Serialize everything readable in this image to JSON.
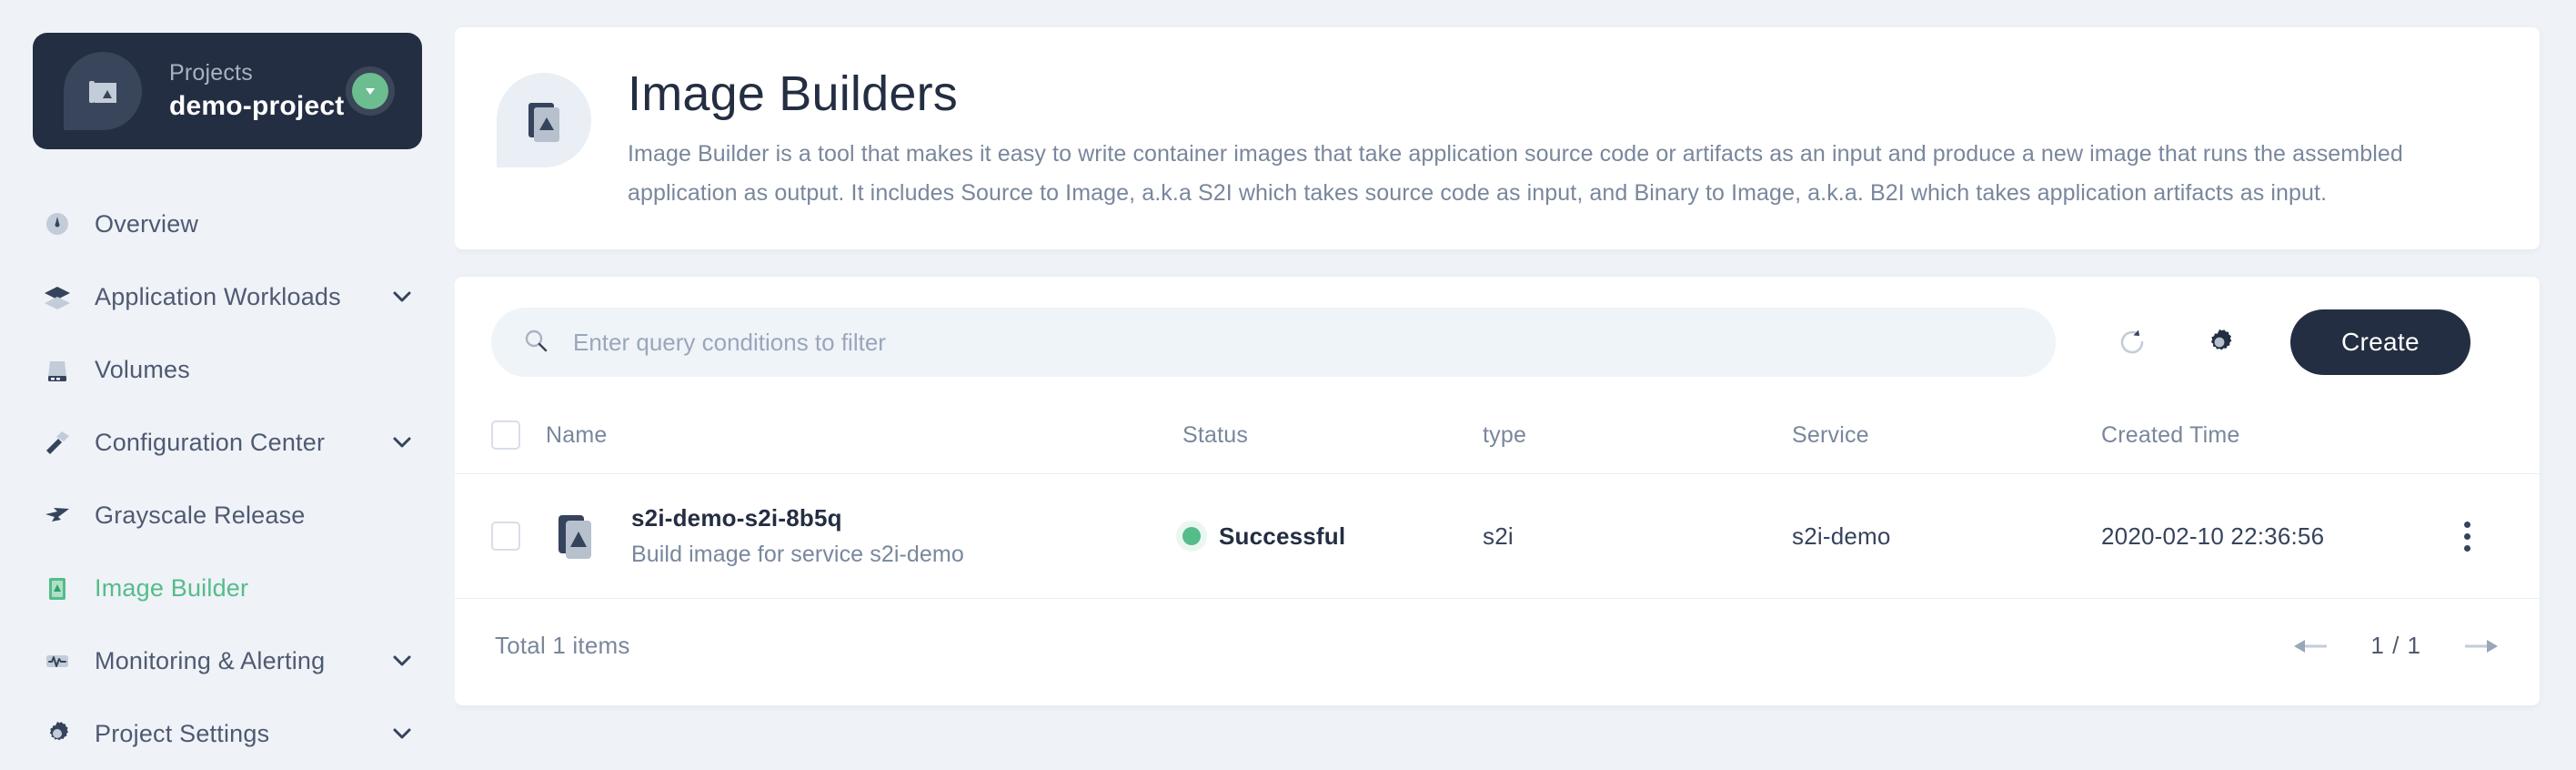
{
  "sidebar": {
    "project_card": {
      "label": "Projects",
      "name": "demo-project",
      "icon": "blueprint-icon",
      "badge_icon": "chevron-down-circle-icon"
    },
    "items": [
      {
        "label": "Overview",
        "icon": "dashboard-icon",
        "expandable": false,
        "active": false
      },
      {
        "label": "Application Workloads",
        "icon": "layers-icon",
        "expandable": true,
        "active": false
      },
      {
        "label": "Volumes",
        "icon": "storage-icon",
        "expandable": false,
        "active": false
      },
      {
        "label": "Configuration Center",
        "icon": "hammer-icon",
        "expandable": true,
        "active": false
      },
      {
        "label": "Grayscale Release",
        "icon": "bird-icon",
        "expandable": false,
        "active": false
      },
      {
        "label": "Image Builder",
        "icon": "image-build-icon",
        "expandable": false,
        "active": true
      },
      {
        "label": "Monitoring & Alerting",
        "icon": "pulse-icon",
        "expandable": true,
        "active": false
      },
      {
        "label": "Project Settings",
        "icon": "gear-icon",
        "expandable": true,
        "active": false
      }
    ]
  },
  "banner": {
    "icon": "image-build-icon",
    "title": "Image Builders",
    "description": "Image Builder is a tool that makes it easy to write container images that take application source code or artifacts as an input and produce a new image that runs the assembled application as output. It includes Source to Image, a.k.a S2I which takes source code as input, and Binary to Image, a.k.a. B2I which takes application artifacts as input."
  },
  "toolbar": {
    "search_placeholder": "Enter query conditions to filter",
    "search_value": "",
    "search_icon": "search-icon",
    "refresh_icon": "refresh-icon",
    "settings_icon": "gear-icon",
    "create_label": "Create"
  },
  "table": {
    "columns": [
      "Name",
      "Status",
      "type",
      "Service",
      "Created Time"
    ],
    "rows": [
      {
        "icon": "image-build-icon",
        "name": "s2i-demo-s2i-8b5q",
        "description": "Build image for service s2i-demo",
        "status": "Successful",
        "status_color": "#55bc8a",
        "type": "s2i",
        "service": "s2i-demo",
        "created_time": "2020-02-10 22:36:56",
        "actions_icon": "kebab-menu-icon"
      }
    ]
  },
  "footer": {
    "total": "Total 1 items",
    "prev_icon": "arrow-left-icon",
    "page_indicator": "1 / 1",
    "next_icon": "arrow-right-icon"
  },
  "colors": {
    "accent_green": "#55bc8a",
    "dark_navy": "#242e42",
    "page_bg": "#eff2f7",
    "muted_text": "#79879c"
  }
}
